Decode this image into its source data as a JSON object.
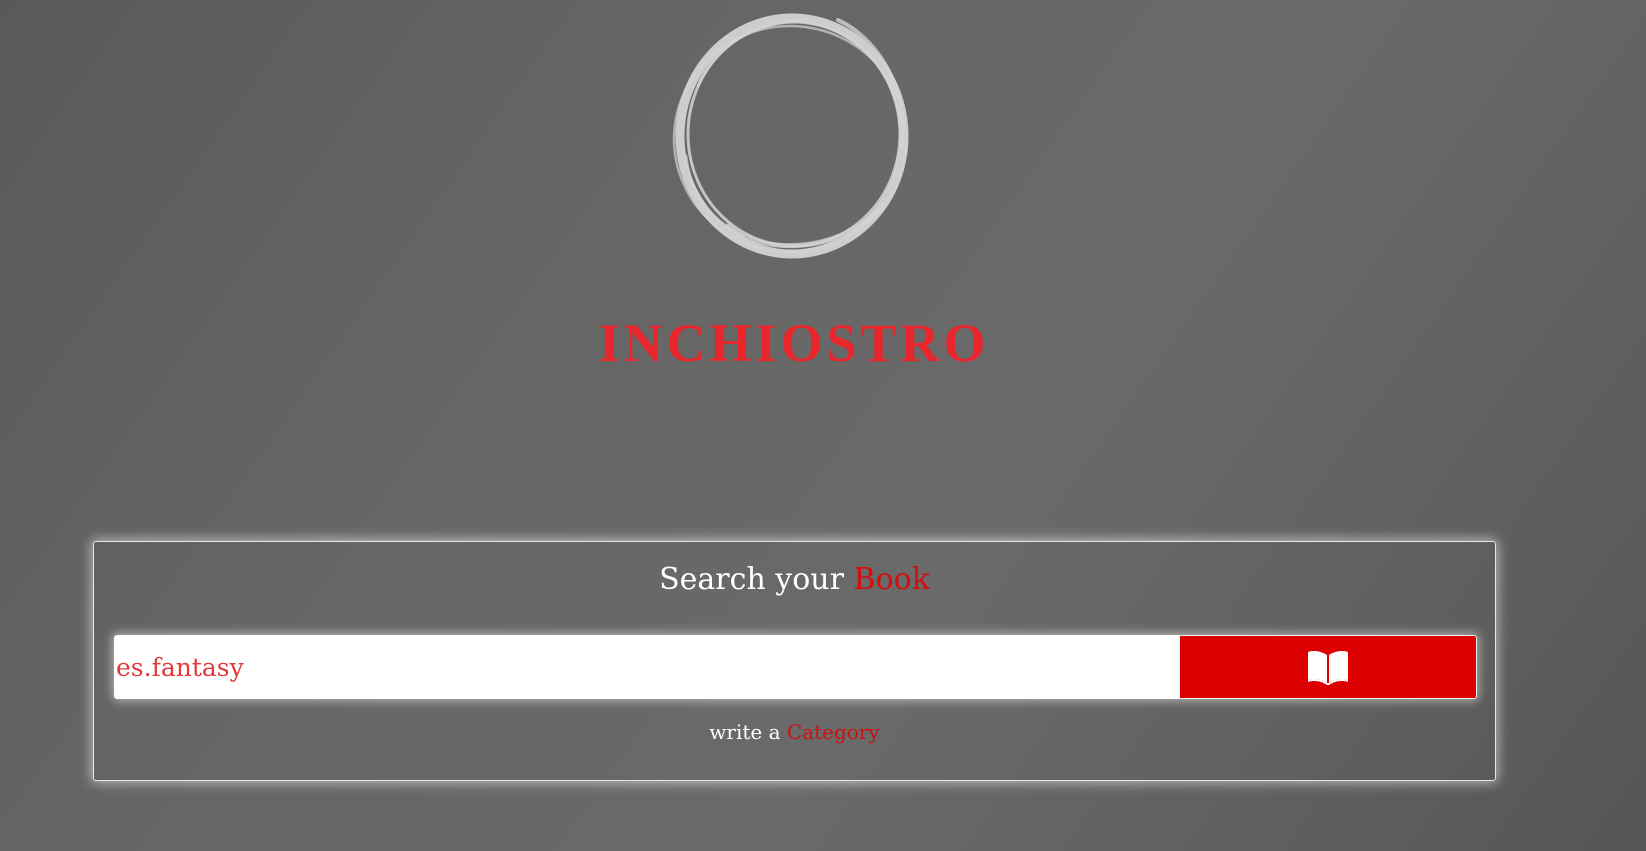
{
  "brand": {
    "name": "INCHIOSTRO",
    "logo_icon": "ink-circle-icon",
    "logo_color": "#d3d3d3",
    "accent_color": "#e8262b"
  },
  "search": {
    "heading_prefix": "Search your",
    "heading_accent": "Book",
    "input_value": "es.fantasy",
    "button_icon": "open-book-icon",
    "button_color": "#dc0000",
    "hint_prefix": "write a",
    "hint_accent": "Category"
  }
}
